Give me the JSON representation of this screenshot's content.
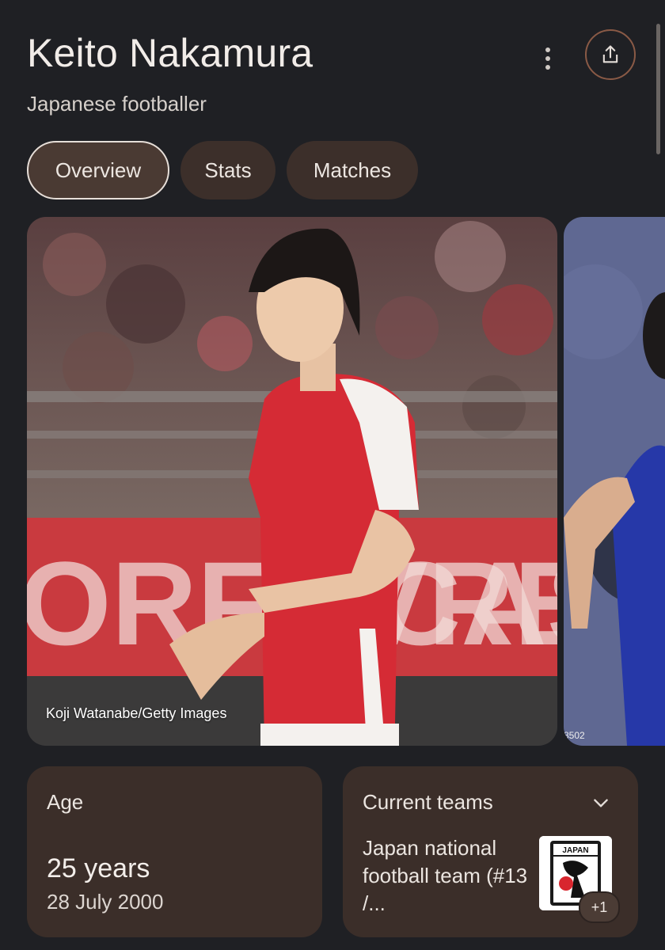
{
  "header": {
    "title": "Keito Nakamura",
    "subtitle": "Japanese footballer"
  },
  "tabs": [
    {
      "label": "Overview",
      "active": true
    },
    {
      "label": "Stats",
      "active": false
    },
    {
      "label": "Matches",
      "active": false
    }
  ],
  "images": {
    "main_credit": "Koji Watanabe/Getty Images",
    "second_credit": "8502"
  },
  "age_card": {
    "label": "Age",
    "value": "25 years",
    "date": "28 July 2000"
  },
  "teams_card": {
    "label": "Current teams",
    "team_text": "Japan national football team (#13 /...",
    "extra_count": "+1"
  },
  "colors": {
    "background": "#1f2024",
    "chip": "#3c2f2a",
    "card": "#3b2e29",
    "accent_border": "#8a5a46",
    "jersey_red": "#d52b35"
  }
}
